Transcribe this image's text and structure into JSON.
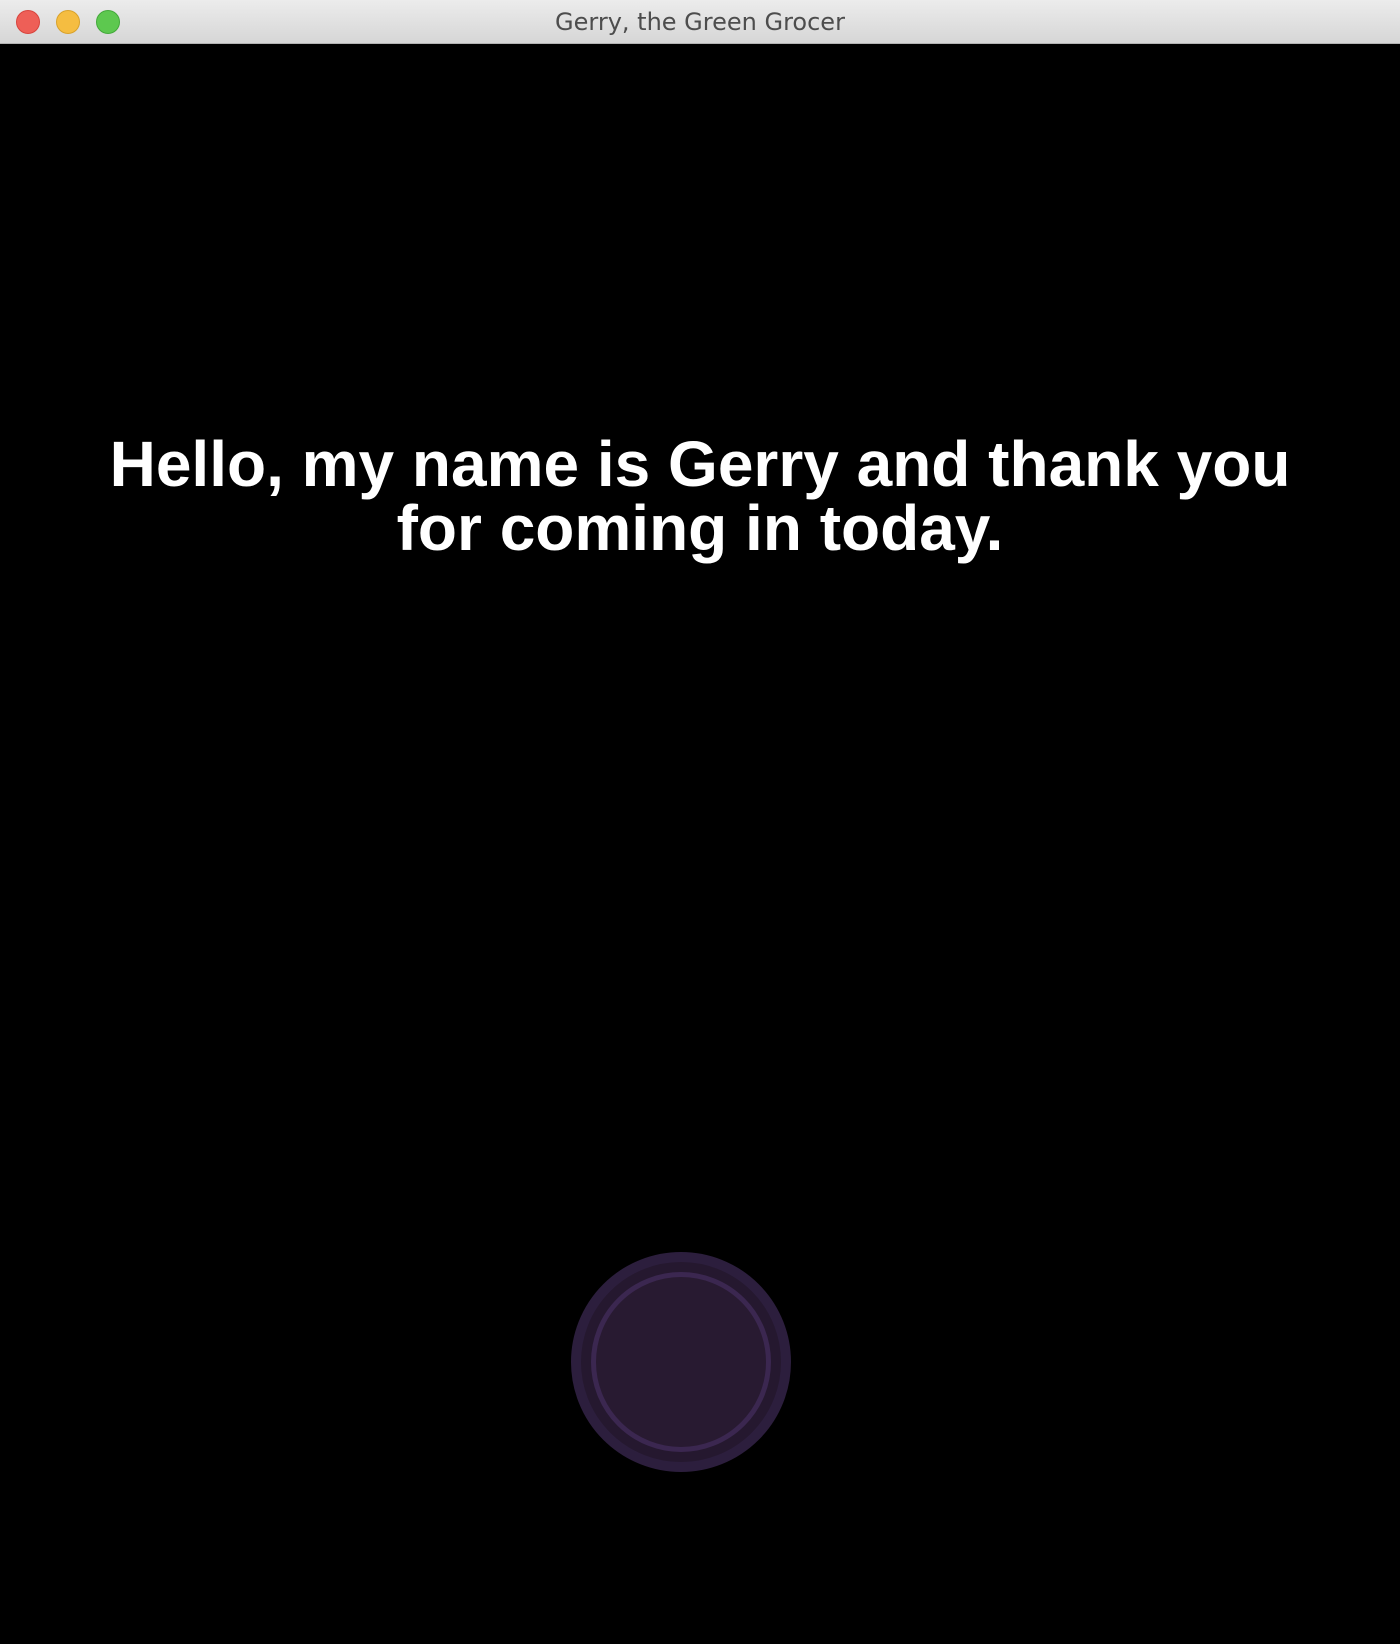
{
  "window": {
    "title": "Gerry, the Green Grocer"
  },
  "main": {
    "message": "Hello, my name is Gerry and thank you for coming in today."
  },
  "colors": {
    "background": "#000000",
    "text": "#ffffff",
    "button_fill": "#281a31",
    "button_ring": "#3b2750"
  }
}
